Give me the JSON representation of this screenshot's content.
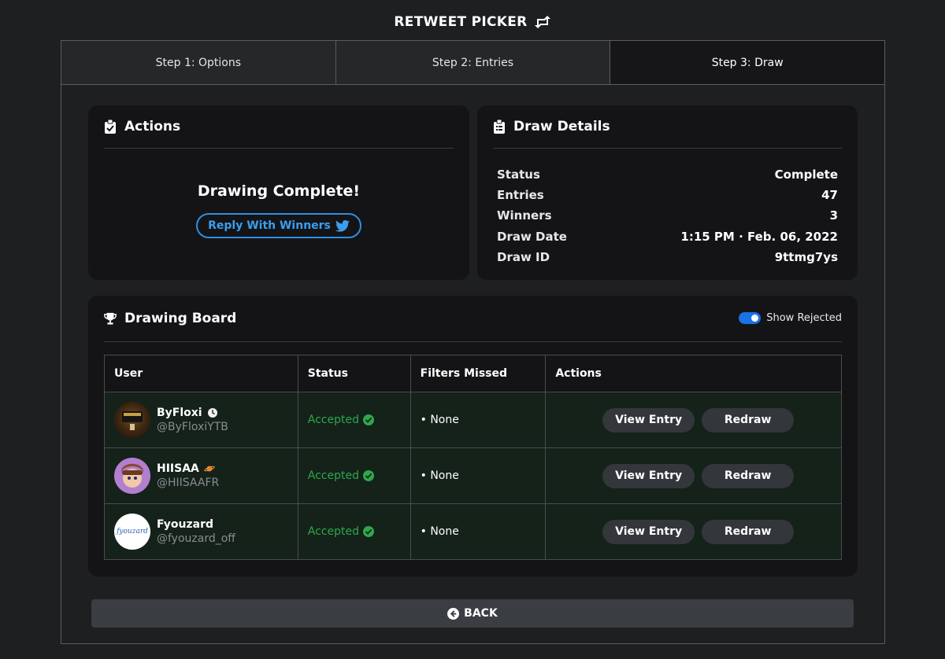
{
  "app": {
    "title": "RETWEET PICKER",
    "title_icon": "retweet-icon"
  },
  "tabs": [
    {
      "label": "Step 1: Options"
    },
    {
      "label": "Step 2: Entries"
    },
    {
      "label": "Step 3: Draw",
      "active": true
    }
  ],
  "actions": {
    "heading": "Actions",
    "heading_icon": "clipboard-check-icon",
    "status_text": "Drawing Complete!",
    "reply_label": "Reply With Winners",
    "reply_icon": "twitter-icon"
  },
  "details": {
    "heading": "Draw Details",
    "heading_icon": "clipboard-list-icon",
    "rows": [
      {
        "label": "Status",
        "value": "Complete"
      },
      {
        "label": "Entries",
        "value": "47"
      },
      {
        "label": "Winners",
        "value": "3"
      },
      {
        "label": "Draw Date",
        "value": "1:15 PM · Feb. 06, 2022"
      },
      {
        "label": "Draw ID",
        "value": "9ttmg7ys"
      }
    ]
  },
  "board": {
    "heading": "Drawing Board",
    "heading_icon": "trophy-icon",
    "toggle_label": "Show Rejected",
    "toggle_on": true,
    "columns": [
      "User",
      "Status",
      "Filters Missed",
      "Actions"
    ],
    "rows": [
      {
        "name": "ByFloxi",
        "handle": "@ByFloxiYTB",
        "badge": "clock-badge-icon",
        "status": "Accepted",
        "filters": "• None",
        "view_label": "View Entry",
        "redraw_label": "Redraw"
      },
      {
        "name": "HIISAA",
        "handle": "@HIISAAFR",
        "badge": "planet-badge-icon",
        "status": "Accepted",
        "filters": "• None",
        "view_label": "View Entry",
        "redraw_label": "Redraw"
      },
      {
        "name": "Fyouzard",
        "handle": "@fyouzard_off",
        "badge": "",
        "status": "Accepted",
        "filters": "• None",
        "view_label": "View Entry",
        "redraw_label": "Redraw",
        "avatar_text": "fyouzard"
      }
    ]
  },
  "back": {
    "label": "BACK",
    "icon": "arrow-left-circle-icon"
  },
  "colors": {
    "accent": "#1a73e8",
    "success": "#2ea84a",
    "twitter": "#3a9ef0"
  }
}
